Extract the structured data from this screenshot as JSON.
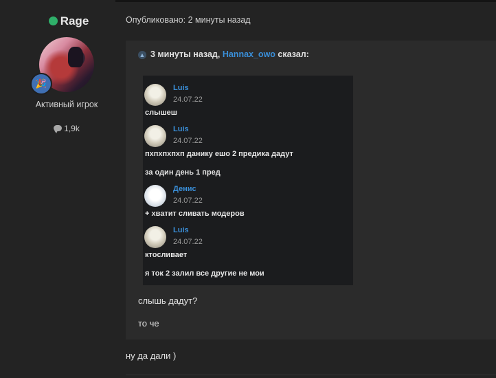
{
  "author": {
    "name": "Rage",
    "online_color": "#2fb06a",
    "title": "Активный игрок",
    "post_count": "1,9k",
    "post_count_icon": "speech-bubble-icon",
    "rank_badge_icon": "party-popper-icon"
  },
  "post": {
    "published": "Опубликовано: 2 минуты назад",
    "quote": {
      "header_time": "3 минуты назад,",
      "header_user": "Hannax_owo",
      "header_suffix": "сказал:",
      "screenshot": {
        "messages": [
          {
            "name": "Luis",
            "date": "24.07.22",
            "lines": [
              "слышеш"
            ]
          },
          {
            "name": "Luis",
            "date": "24.07.22",
            "lines": [
              "пхпхпхпхп данику ешо 2 предика дадут",
              "за один день 1 пред"
            ]
          },
          {
            "name": "Денис",
            "date": "24.07.22",
            "lines": [
              "+ хватит сливать модеров"
            ]
          },
          {
            "name": "Luis",
            "date": "24.07.22",
            "lines": [
              "ктосливает",
              "я ток 2 залил все другие не мои"
            ]
          }
        ]
      },
      "lines": [
        "слышь дадут?",
        "то че"
      ]
    },
    "reply": "ну да дали )"
  },
  "colors": {
    "link": "#3a8fd9",
    "background": "#232323",
    "quote_background": "#2b2b2b"
  }
}
